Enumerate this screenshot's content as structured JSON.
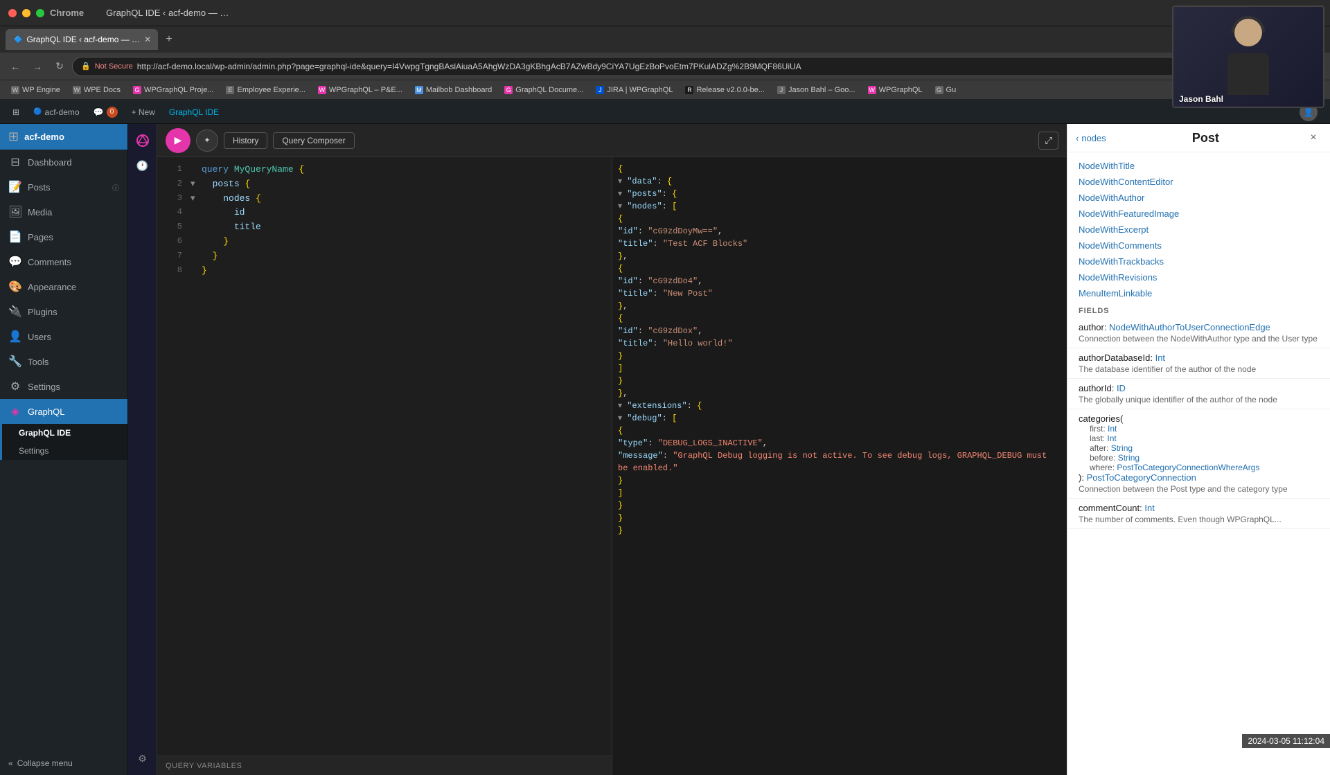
{
  "browser": {
    "title": "GraphQL IDE ‹ acf-demo — …",
    "tab_label": "GraphQL IDE ‹ acf-demo — …",
    "url": "http://acf-demo.local/wp-admin/admin.php?page=graphql-ide&query=I4VwpgTgngBAslAiuaA5AhgWzDA3gKBhgAcB7AZwBdy9CiYA7UgEzBoPvoEtm7PKulADZg%2B9MQF86UiUA",
    "not_secure": "Not Secure"
  },
  "bookmarks": [
    {
      "label": "WP Engine",
      "icon": "W"
    },
    {
      "label": "WPE Docs",
      "icon": "W"
    },
    {
      "label": "WPGraphQL Proje...",
      "icon": "G"
    },
    {
      "label": "Employee Experie...",
      "icon": "E"
    },
    {
      "label": "WPGraphQL – P&E...",
      "icon": "W"
    },
    {
      "label": "Mailbob Dashboard",
      "icon": "M"
    },
    {
      "label": "GraphQL Docume...",
      "icon": "G"
    },
    {
      "label": "JIRA | WPGraphQL",
      "icon": "J"
    },
    {
      "label": "Release v2.0.0-be...",
      "icon": "R"
    },
    {
      "label": "Jason Bahl – Goo...",
      "icon": "J"
    },
    {
      "label": "WPGraphQL",
      "icon": "W"
    },
    {
      "label": "Gu",
      "icon": "G"
    }
  ],
  "wp_admin_bar": {
    "wp_logo": "⊞",
    "site_name": "acf-demo",
    "comments_count": "0",
    "new_label": "+ New",
    "plugin_label": "GraphQL IDE"
  },
  "sidebar": {
    "site_name": "acf-demo",
    "menu_items": [
      {
        "label": "Dashboard",
        "icon": "⊟",
        "active": false
      },
      {
        "label": "Posts",
        "icon": "📝",
        "active": false
      },
      {
        "label": "Media",
        "icon": "🖼",
        "active": false
      },
      {
        "label": "Pages",
        "icon": "📄",
        "active": false
      },
      {
        "label": "Comments",
        "icon": "💬",
        "active": false
      },
      {
        "label": "Appearance",
        "icon": "🎨",
        "active": false
      },
      {
        "label": "Plugins",
        "icon": "🔌",
        "active": false
      },
      {
        "label": "Users",
        "icon": "👤",
        "active": false
      },
      {
        "label": "Tools",
        "icon": "🔧",
        "active": false
      },
      {
        "label": "Settings",
        "icon": "⚙",
        "active": false
      },
      {
        "label": "GraphQL",
        "icon": "◈",
        "active": true
      }
    ],
    "graphql_submenu": [
      {
        "label": "GraphQL IDE",
        "active": true
      },
      {
        "label": "Settings",
        "active": false
      }
    ],
    "collapse_label": "Collapse menu"
  },
  "toolbar": {
    "run_label": "▶",
    "prettify_label": "✦",
    "history_label": "History",
    "query_composer_label": "Query Composer",
    "expand_label": "⤢"
  },
  "query": {
    "lines": [
      {
        "num": 1,
        "arrow": "·",
        "content": "query MyQueryName {",
        "tokens": [
          {
            "text": "query ",
            "class": "kw-query"
          },
          {
            "text": "MyQueryName",
            "class": "kw-name"
          },
          {
            "text": " {",
            "class": ""
          }
        ]
      },
      {
        "num": 2,
        "arrow": "▾",
        "content": "  posts {",
        "tokens": [
          {
            "text": "  posts ",
            "class": "kw-field"
          },
          {
            "text": "{",
            "class": ""
          }
        ]
      },
      {
        "num": 3,
        "arrow": "▾",
        "content": "    nodes {",
        "tokens": [
          {
            "text": "    nodes ",
            "class": "kw-field"
          },
          {
            "text": "{",
            "class": ""
          }
        ]
      },
      {
        "num": 4,
        "arrow": "",
        "content": "      id",
        "tokens": [
          {
            "text": "      id",
            "class": "kw-field"
          }
        ]
      },
      {
        "num": 5,
        "arrow": "",
        "content": "      title",
        "tokens": [
          {
            "text": "      title",
            "class": "kw-field"
          }
        ]
      },
      {
        "num": 6,
        "arrow": "",
        "content": "    }",
        "tokens": [
          {
            "text": "    }",
            "class": ""
          }
        ]
      },
      {
        "num": 7,
        "arrow": "",
        "content": "  }",
        "tokens": [
          {
            "text": "  }",
            "class": ""
          }
        ]
      },
      {
        "num": 8,
        "arrow": "",
        "content": "}",
        "tokens": [
          {
            "text": "}",
            "class": ""
          }
        ]
      }
    ],
    "variables_label": "QUERY VARIABLES"
  },
  "result": {
    "lines": [
      "{ ",
      "  ▾ \"data\": {",
      "    ▾ \"posts\": {",
      "      ▾ \"nodes\": [",
      "          {",
      "            \"id\": \"cG9zdDoyMw==\",",
      "            \"title\": \"Test ACF Blocks\"",
      "          },",
      "          {",
      "            \"id\": \"cG9zdDo4\",",
      "            \"title\": \"New Post\"",
      "          },",
      "          {",
      "            \"id\": \"cG9zdDox\",",
      "            \"title\": \"Hello world!\"",
      "          }",
      "        ]",
      "      }",
      "    },",
      "  ▾ \"extensions\": {",
      "    ▾ \"debug\": [",
      "        {",
      "          \"type\": \"DEBUG_LOGS_INACTIVE\",",
      "          \"message\": \"GraphQL Debug logging is not active. To see debug logs, GRAPHQL_DEBUG must be enabled.\"",
      "        }",
      "      ]",
      "    }",
      "  }",
      "}"
    ]
  },
  "right_panel": {
    "back_label": "nodes",
    "title": "Post",
    "close": "×",
    "type_links": [
      "NodeWithTitle",
      "NodeWithContentEditor",
      "NodeWithAuthor",
      "NodeWithFeaturedImage",
      "NodeWithExcerpt",
      "NodeWithComments",
      "NodeWithTrackbacks",
      "NodeWithRevisions",
      "MenuItemLinkable"
    ],
    "fields_header": "FIELDS",
    "fields": [
      {
        "name": "author",
        "type": "NodeWithAuthorToUserConnectionEdge",
        "desc": "Connection between the NodeWithAuthor type and the User type",
        "args": []
      },
      {
        "name": "authorDatabaseId",
        "type": "Int",
        "desc": "The database identifier of the author of the node",
        "args": []
      },
      {
        "name": "authorId",
        "type": "ID",
        "desc": "The globally unique identifier of the author of the node",
        "args": []
      },
      {
        "name": "categories(",
        "type": "",
        "desc": "",
        "args": [
          {
            "name": "first",
            "type": "Int"
          },
          {
            "name": "last",
            "type": "Int"
          },
          {
            "name": "after",
            "type": "String"
          },
          {
            "name": "before",
            "type": "String"
          },
          {
            "name": "where",
            "type": "PostToCategoryConnectionWhereArgs"
          }
        ],
        "close_type": "PostToCategoryConnection",
        "close_desc": "Connection between the Post type and the category type"
      },
      {
        "name": "commentCount",
        "type": "Int",
        "desc": "The number of comments. Even though WPGraphQL...",
        "args": []
      }
    ]
  },
  "webcam": {
    "name": "Jason Bahl"
  },
  "timestamp": "2024-03-05  11:12:04"
}
